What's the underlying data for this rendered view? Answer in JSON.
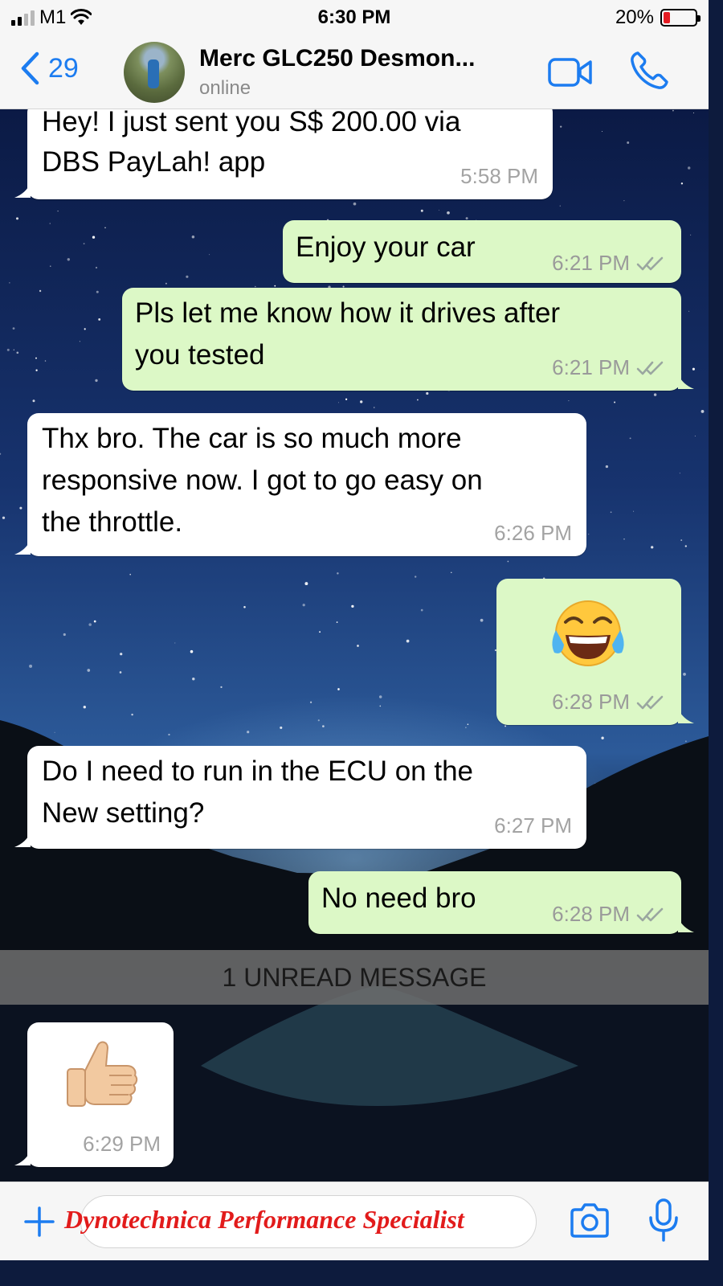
{
  "status_bar": {
    "carrier": "M1",
    "time": "6:30 PM",
    "battery": "20%",
    "battery_level": 0.2
  },
  "header": {
    "back_count": "29",
    "contact_name": "Merc GLC250 Desmon...",
    "contact_status": "online",
    "icons": [
      "chevron-left-icon",
      "video-camera-icon",
      "phone-icon"
    ]
  },
  "messages": [
    {
      "direction": "in",
      "text": [
        "Hey! I just sent you S$ 200.00 via",
        "DBS PayLah! app"
      ],
      "time": "5:58 PM"
    },
    {
      "direction": "out",
      "text": [
        "Enjoy your car"
      ],
      "time": "6:21 PM",
      "read": true
    },
    {
      "direction": "out",
      "text": [
        "Pls let me know how it drives after",
        "you tested"
      ],
      "time": "6:21 PM",
      "read": true
    },
    {
      "direction": "in",
      "text": [
        "Thx bro. The car is so much more",
        "responsive now. I got to go easy on",
        "the throttle."
      ],
      "time": "6:26 PM"
    },
    {
      "direction": "out",
      "emoji": "face-with-tears-of-joy",
      "time": "6:28 PM",
      "read": true
    },
    {
      "direction": "in",
      "text": [
        "Do I need to run in the ECU on the",
        "New setting?"
      ],
      "time": "6:27 PM"
    },
    {
      "direction": "out",
      "text": [
        "No need bro"
      ],
      "time": "6:28 PM",
      "read": true
    },
    {
      "direction": "in",
      "emoji": "thumbs-up",
      "time": "6:29 PM"
    }
  ],
  "unread_banner": "1 UNREAD MESSAGE",
  "input_bar": {
    "overlay_text": "Dynotechnica Performance Specialist",
    "icons": [
      "plus-icon",
      "camera-icon",
      "microphone-icon"
    ]
  },
  "colors": {
    "accent": "#1c7cf0",
    "outgoing_bubble": "#dcf8c6",
    "incoming_bubble": "#ffffff",
    "read_ticks": "#34b7f1",
    "overlay_text": "#e21b1b"
  }
}
